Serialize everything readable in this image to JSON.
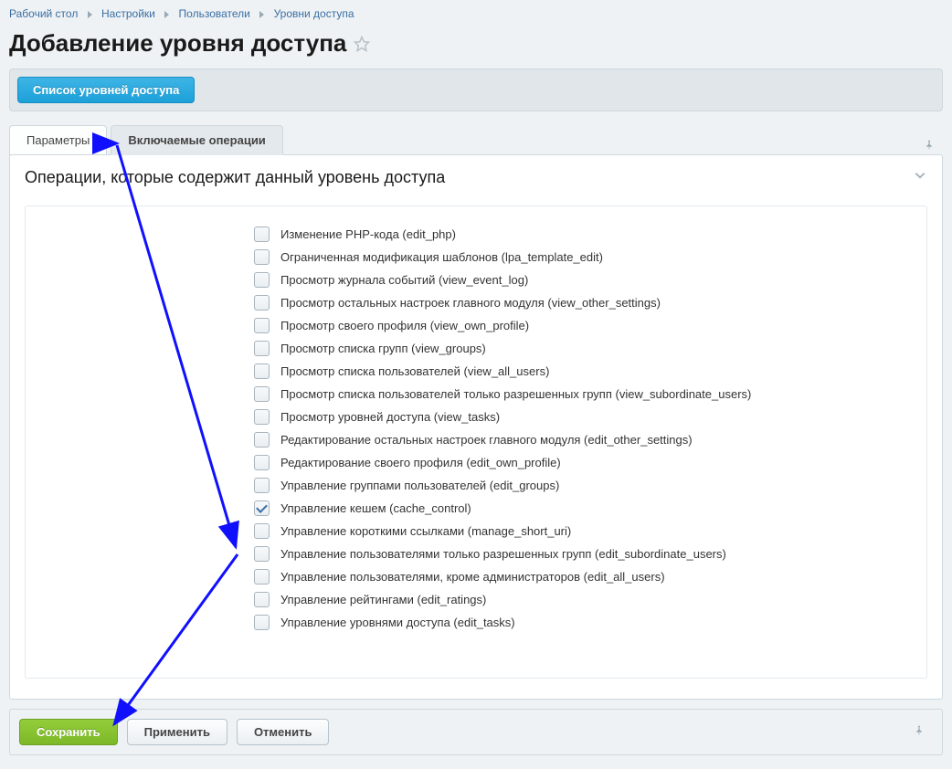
{
  "breadcrumbs": [
    "Рабочий стол",
    "Настройки",
    "Пользователи",
    "Уровни доступа"
  ],
  "page_title": "Добавление уровня доступа",
  "top_button": "Список уровней доступа",
  "tabs": {
    "params": "Параметры",
    "ops": "Включаемые операции"
  },
  "section_title": "Операции, которые содержит данный уровень доступа",
  "operations": [
    {
      "label": "Изменение PHP-кода (edit_php)",
      "checked": false
    },
    {
      "label": "Ограниченная модификация шаблонов (lpa_template_edit)",
      "checked": false
    },
    {
      "label": "Просмотр журнала событий (view_event_log)",
      "checked": false
    },
    {
      "label": "Просмотр остальных настроек главного модуля (view_other_settings)",
      "checked": false
    },
    {
      "label": "Просмотр своего профиля (view_own_profile)",
      "checked": false
    },
    {
      "label": "Просмотр списка групп (view_groups)",
      "checked": false
    },
    {
      "label": "Просмотр списка пользователей (view_all_users)",
      "checked": false
    },
    {
      "label": "Просмотр списка пользователей только разрешенных групп (view_subordinate_users)",
      "checked": false
    },
    {
      "label": "Просмотр уровней доступа (view_tasks)",
      "checked": false
    },
    {
      "label": "Редактирование остальных настроек главного модуля (edit_other_settings)",
      "checked": false
    },
    {
      "label": "Редактирование своего профиля (edit_own_profile)",
      "checked": false
    },
    {
      "label": "Управление группами пользователей (edit_groups)",
      "checked": false
    },
    {
      "label": "Управление кешем (cache_control)",
      "checked": true
    },
    {
      "label": "Управление короткими ссылками (manage_short_uri)",
      "checked": false
    },
    {
      "label": "Управление пользователями только разрешенных групп (edit_subordinate_users)",
      "checked": false
    },
    {
      "label": "Управление пользователями, кроме администраторов (edit_all_users)",
      "checked": false
    },
    {
      "label": "Управление рейтингами (edit_ratings)",
      "checked": false
    },
    {
      "label": "Управление уровнями доступа (edit_tasks)",
      "checked": false
    }
  ],
  "footer": {
    "save": "Сохранить",
    "apply": "Применить",
    "cancel": "Отменить"
  }
}
